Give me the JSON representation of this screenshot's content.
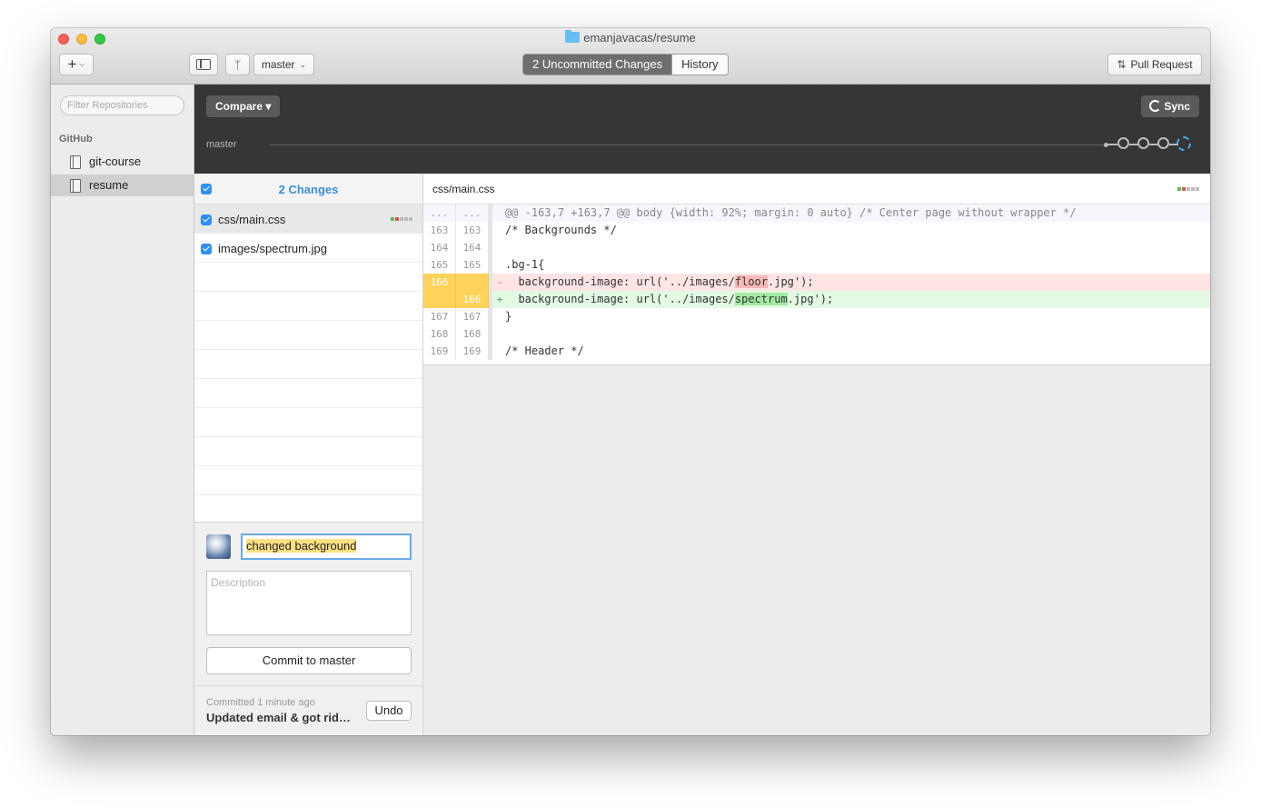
{
  "window": {
    "title": "emanjavacas/resume"
  },
  "toolbar": {
    "add_label": "+",
    "branch": "master",
    "tabs": [
      {
        "label": "2 Uncommitted Changes",
        "active": true
      },
      {
        "label": "History",
        "active": false
      }
    ],
    "pull_request_label": "Pull Request"
  },
  "sidebar": {
    "filter_placeholder": "Filter Repositories",
    "section": "GitHub",
    "repos": [
      {
        "name": "git-course",
        "selected": false
      },
      {
        "name": "resume",
        "selected": true
      }
    ]
  },
  "compare_bar": {
    "compare_label": "Compare ▾",
    "sync_label": "Sync",
    "branch_label": "master"
  },
  "changes": {
    "title": "2 Changes",
    "files": [
      {
        "name": "css/main.css",
        "selected": true
      },
      {
        "name": "images/spectrum.jpg",
        "selected": false
      }
    ]
  },
  "commit": {
    "summary": "changed background",
    "description_placeholder": "Description",
    "commit_button": "Commit to master",
    "last_commit_when": "Committed 1 minute ago",
    "last_commit_message": "Updated email & got rid…",
    "undo_label": "Undo"
  },
  "diff": {
    "file": "css/main.css",
    "lines": [
      {
        "type": "hunk",
        "old": "...",
        "new": "...",
        "sign": "",
        "code": "@@ -163,7 +163,7 @@ body {width: 92%; margin: 0 auto} /* Center page without wrapper */"
      },
      {
        "type": "ctx",
        "old": "163",
        "new": "163",
        "sign": "",
        "code": "/* Backgrounds */"
      },
      {
        "type": "ctx",
        "old": "164",
        "new": "164",
        "sign": "",
        "code": ""
      },
      {
        "type": "ctx",
        "old": "165",
        "new": "165",
        "sign": "",
        "code": ".bg-1{"
      },
      {
        "type": "del",
        "old": "166",
        "new": "",
        "sign": "-",
        "code_pre": "  background-image: url('../images/",
        "code_hl": "floor",
        "code_post": ".jpg');"
      },
      {
        "type": "add",
        "old": "",
        "new": "166",
        "sign": "+",
        "code_pre": "  background-image: url('../images/",
        "code_hl": "spectrum",
        "code_post": ".jpg');"
      },
      {
        "type": "ctx",
        "old": "167",
        "new": "167",
        "sign": "",
        "code": "}"
      },
      {
        "type": "ctx",
        "old": "168",
        "new": "168",
        "sign": "",
        "code": ""
      },
      {
        "type": "ctx",
        "old": "169",
        "new": "169",
        "sign": "",
        "code": "/* Header */"
      }
    ]
  },
  "colors": {
    "accent": "#3a8fd8",
    "deleted": "#ffe4e4",
    "added": "#e3f9e3",
    "changed_line_number": "#ffd35a"
  }
}
